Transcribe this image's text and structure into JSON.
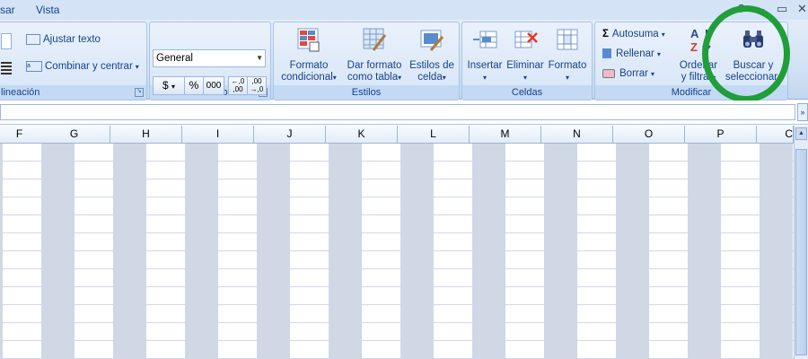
{
  "tabs": [
    {
      "label": "sar"
    },
    {
      "label": "Vista"
    }
  ],
  "window_controls": {
    "minimize": "–",
    "restore": "▭",
    "close": "✕"
  },
  "groups": {
    "alineacion": {
      "label": "lineación",
      "ajustar_texto": "Ajustar texto",
      "combinar": "Combinar y centrar"
    },
    "numero": {
      "label": "Número",
      "format_value": "General",
      "currency": "$",
      "percent": "%",
      "thousands": "000",
      "dec_inc": "←,0\n,00",
      "dec_dec": ",00\n→,0"
    },
    "estilos": {
      "label": "Estilos",
      "formato_condicional": [
        "Formato",
        "condicional"
      ],
      "dar_formato": [
        "Dar formato",
        "como tabla"
      ],
      "estilos_celda": [
        "Estilos de",
        "celda"
      ]
    },
    "celdas": {
      "label": "Celdas",
      "insertar": "Insertar",
      "eliminar": "Eliminar",
      "formato": "Formato"
    },
    "modificar": {
      "label": "Modificar",
      "autosuma": "Autosuma",
      "rellenar": "Rellenar",
      "borrar": "Borrar",
      "ordenar": [
        "Ordenar",
        "y filtrar"
      ],
      "buscar": [
        "Buscar y",
        "seleccionar"
      ]
    }
  },
  "columns": [
    "F",
    "G",
    "H",
    "I",
    "J",
    "K",
    "L",
    "M",
    "N",
    "O",
    "P",
    "C"
  ],
  "colors": {
    "highlight_circle": "#1f9e3a",
    "ribbon": "#dbe7f6",
    "grid": "#d0d7e5"
  }
}
